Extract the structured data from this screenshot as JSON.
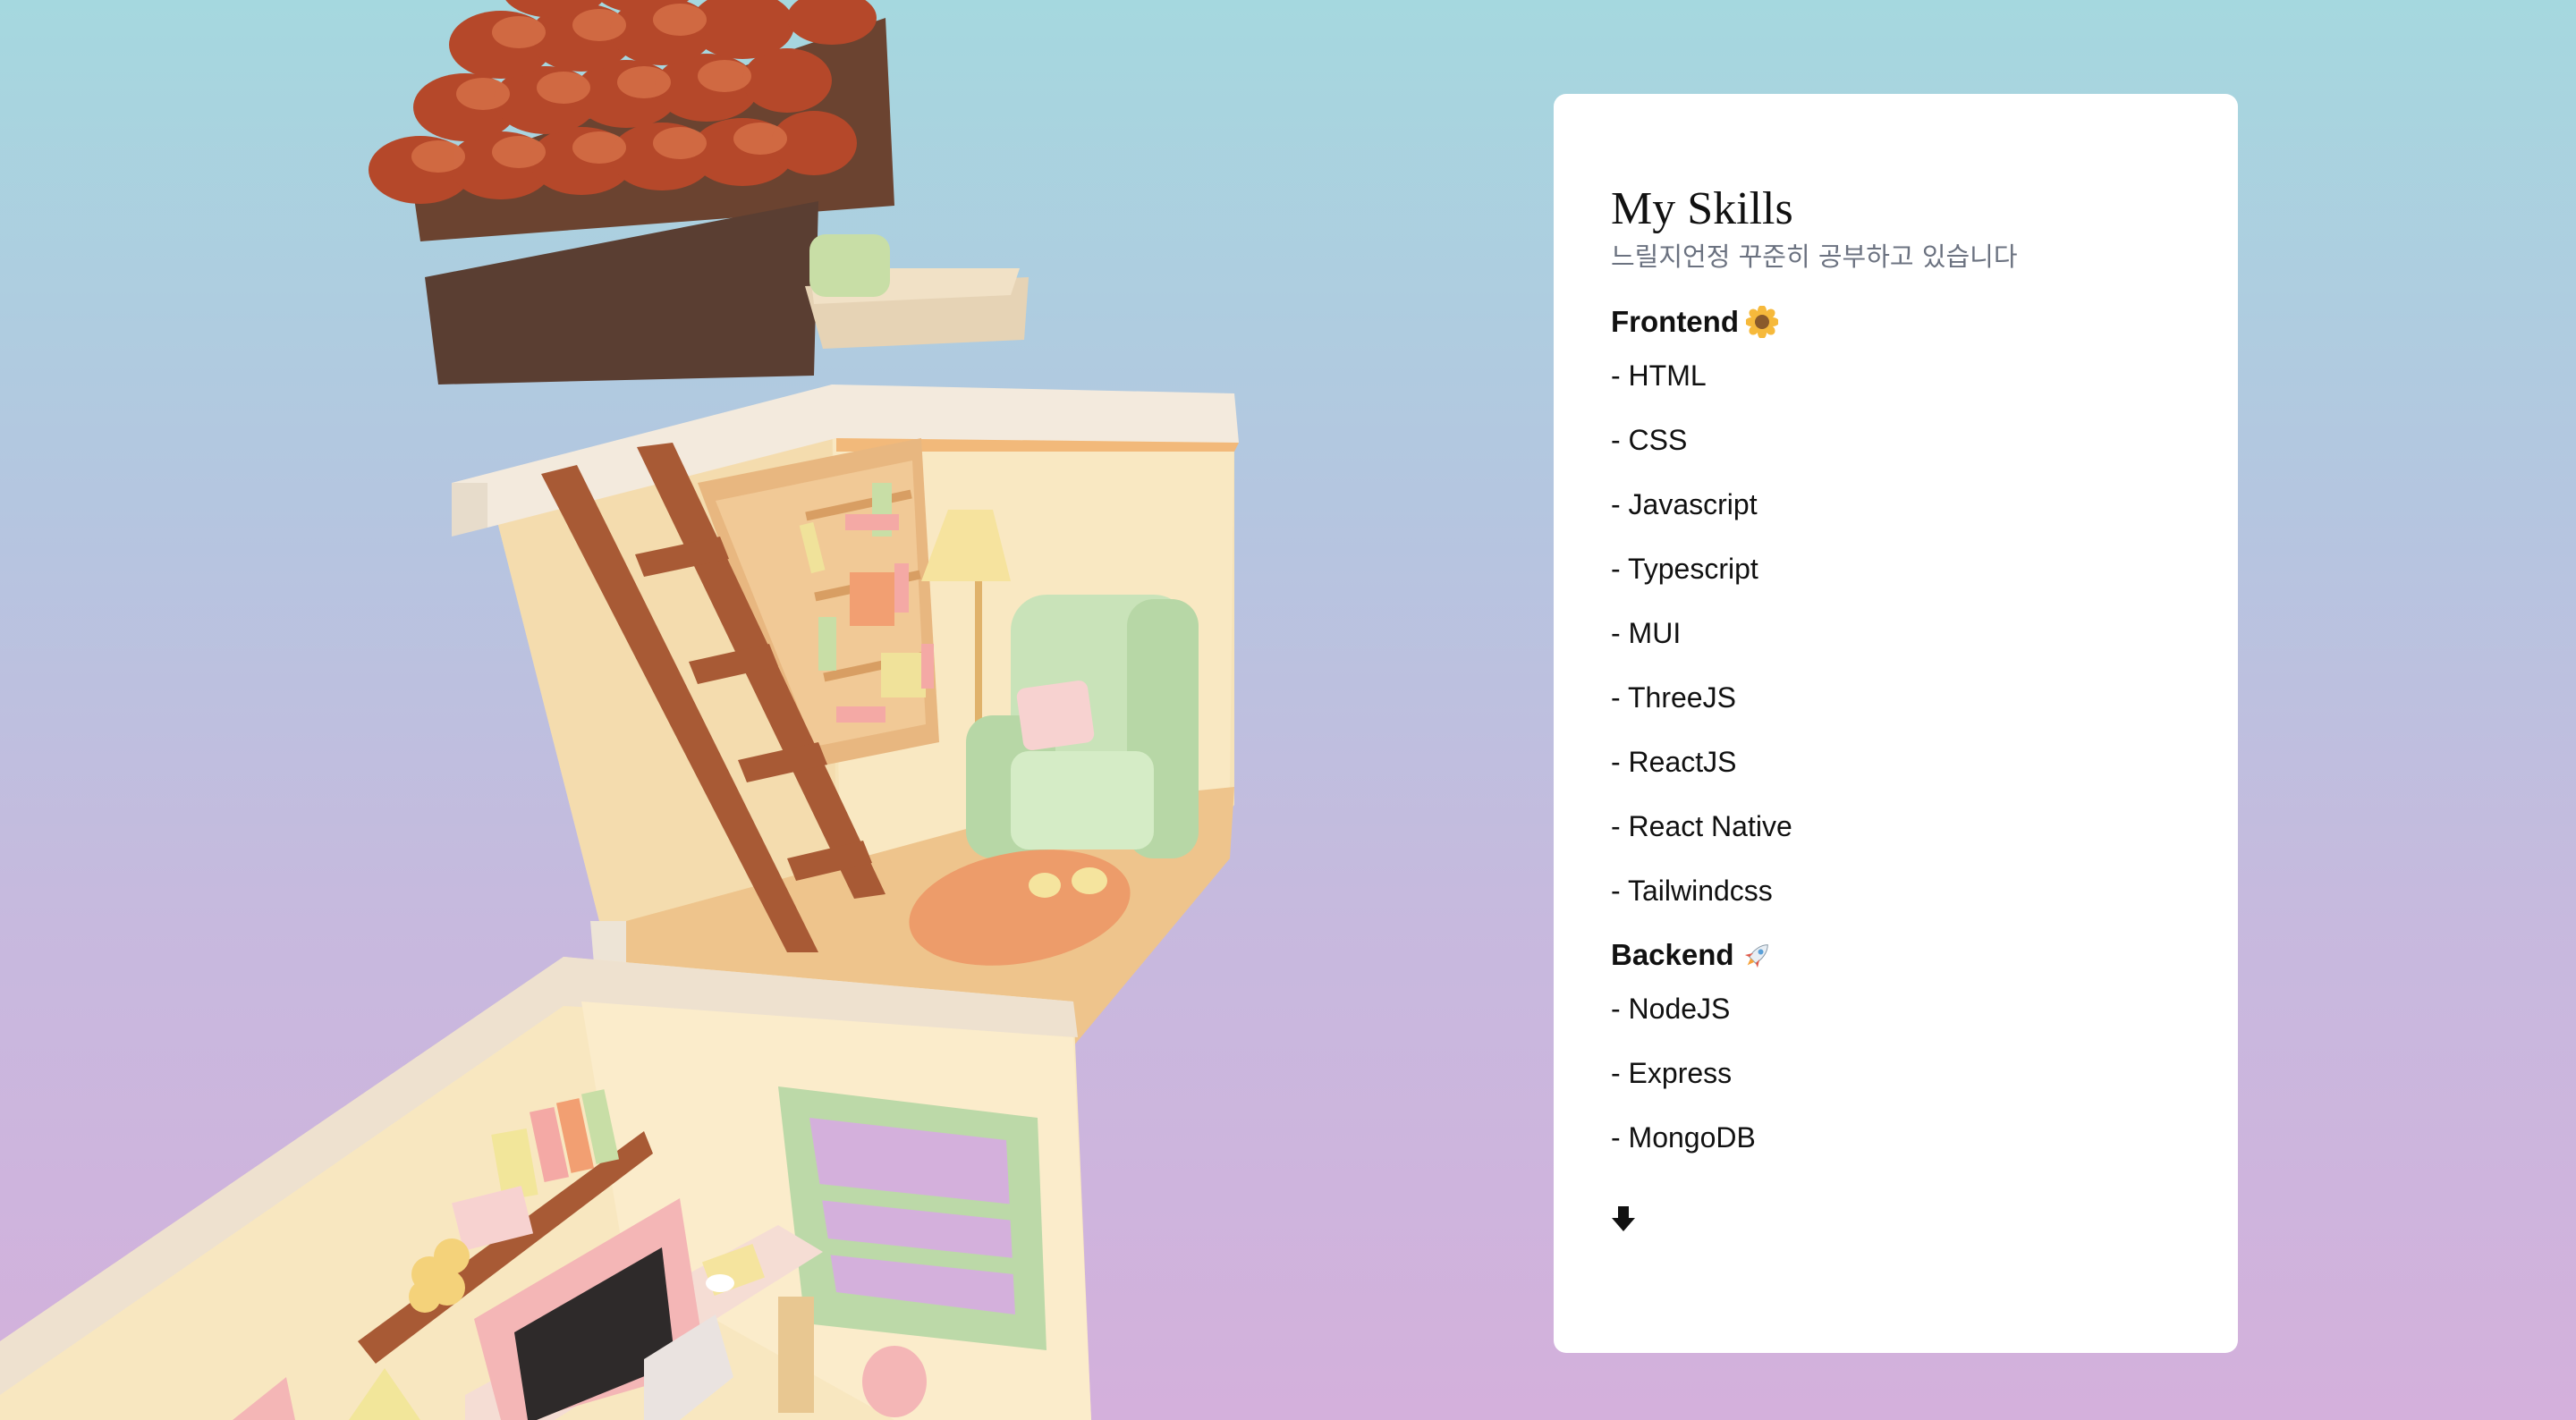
{
  "skills_card": {
    "title": "My Skills",
    "subtitle": "느릴지언정 꾸준히 공부하고 있습니다",
    "frontend": {
      "heading": "Frontend",
      "icon": "sunflower-icon",
      "items": [
        "- HTML",
        "- CSS",
        "- Javascript",
        "- Typescript",
        "- MUI",
        "- ThreeJS",
        "- ReactJS",
        "- React Native",
        "- Tailwindcss"
      ]
    },
    "backend": {
      "heading": "Backend",
      "icon": "rocket-icon",
      "items": [
        "- NodeJS",
        "- Express",
        "- MongoDB"
      ]
    },
    "scroll_icon": "down-arrow-icon"
  },
  "colors": {
    "background_top": "#a5d8df",
    "background_bottom": "#d4b0dc",
    "card_bg": "#ffffff",
    "subtitle": "#6b7280"
  }
}
